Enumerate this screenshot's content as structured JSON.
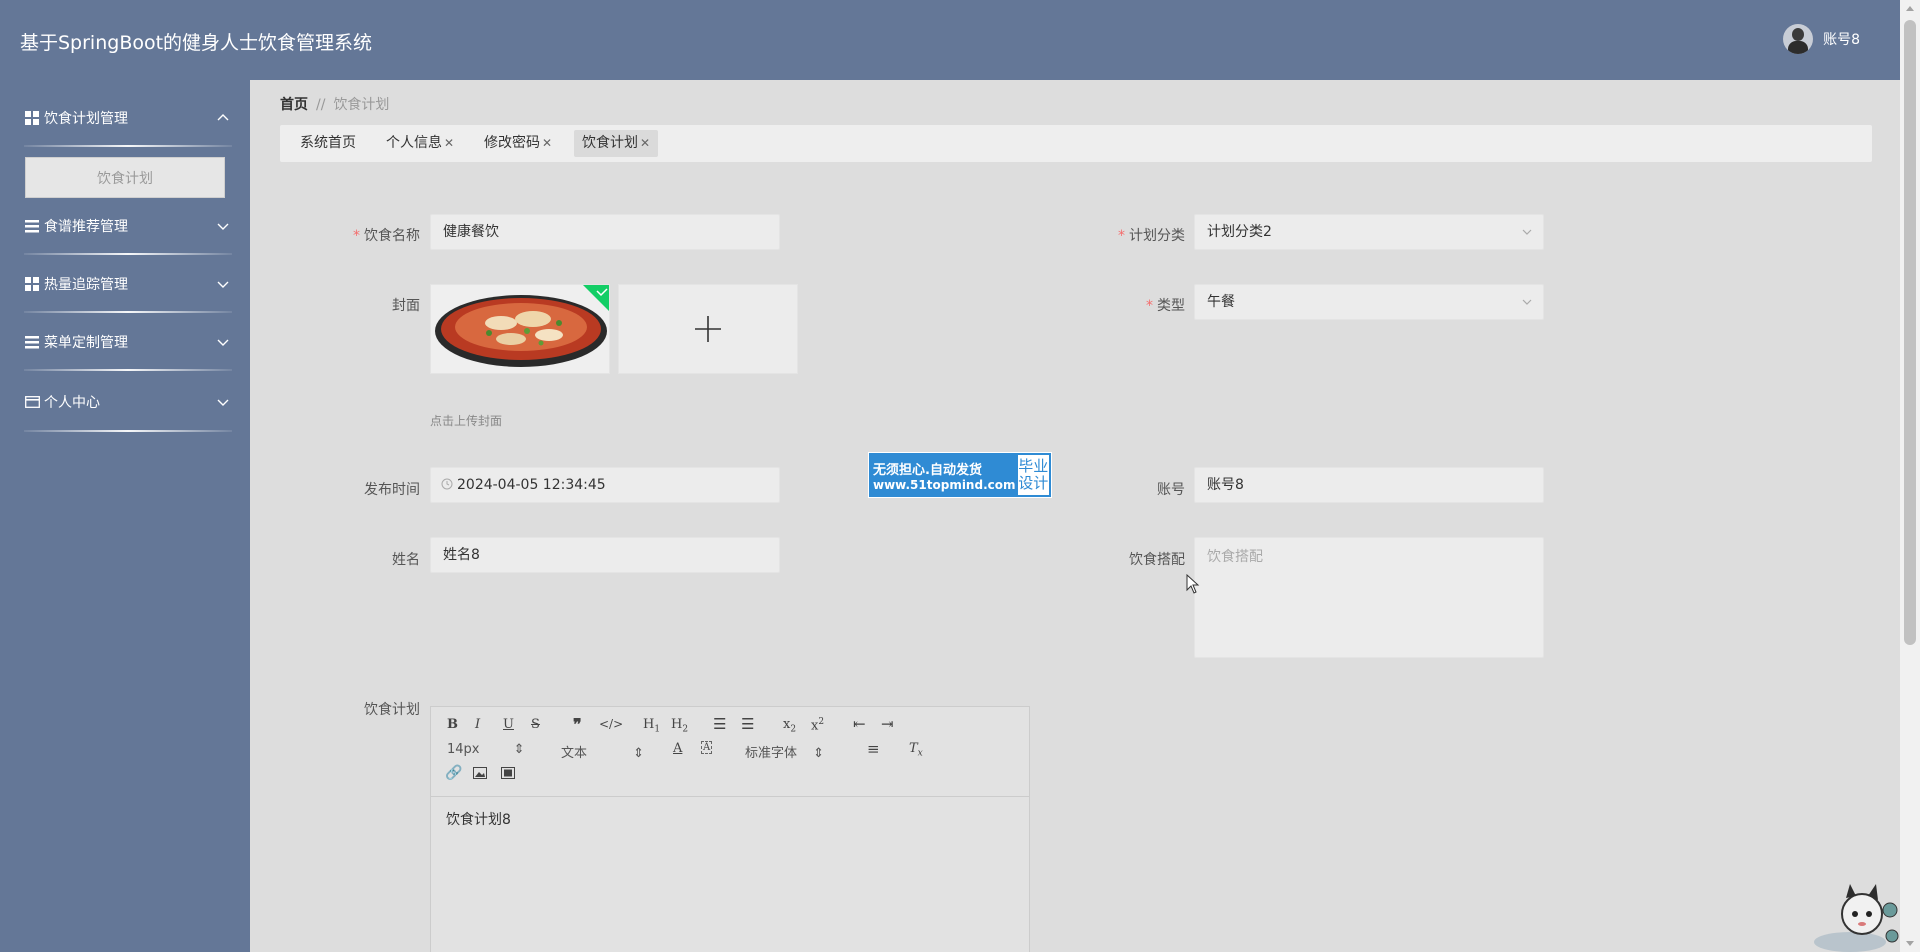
{
  "app": {
    "title": "基于SpringBoot的健身人士饮食管理系统"
  },
  "user": {
    "name": "账号8"
  },
  "sidebar": {
    "items": [
      {
        "label": "饮食计划管理",
        "icon": "grid-icon",
        "expanded": true,
        "submenu": [
          {
            "label": "饮食计划"
          }
        ]
      },
      {
        "label": "食谱推荐管理",
        "icon": "list-icon",
        "expanded": false
      },
      {
        "label": "热量追踪管理",
        "icon": "grid-icon",
        "expanded": false
      },
      {
        "label": "菜单定制管理",
        "icon": "list-icon",
        "expanded": false
      },
      {
        "label": "个人中心",
        "icon": "card-icon",
        "expanded": false
      }
    ]
  },
  "breadcrumb": {
    "home": "首页",
    "separator": "//",
    "current": "饮食计划"
  },
  "tabs": [
    {
      "label": "系统首页",
      "closable": false
    },
    {
      "label": "个人信息",
      "closable": true
    },
    {
      "label": "修改密码",
      "closable": true
    },
    {
      "label": "饮食计划",
      "closable": true,
      "active": true
    }
  ],
  "form": {
    "name": {
      "label": "饮食名称",
      "value": "健康餐饮",
      "required": true
    },
    "category": {
      "label": "计划分类",
      "value": "计划分类2",
      "required": true
    },
    "cover": {
      "label": "封面",
      "tip": "点击上传封面"
    },
    "type": {
      "label": "类型",
      "value": "午餐",
      "required": true
    },
    "publish_time": {
      "label": "发布时间",
      "value": "2024-04-05 12:34:45"
    },
    "account": {
      "label": "账号",
      "value": "账号8"
    },
    "real_name": {
      "label": "姓名",
      "value": "姓名8"
    },
    "diet_match": {
      "label": "饮食搭配",
      "placeholder": "饮食搭配"
    },
    "plan": {
      "label": "饮食计划",
      "content": "饮食计划8"
    }
  },
  "editor": {
    "font_size": "14px",
    "header_select": "文本",
    "font_family": "标准字体",
    "buttons": [
      "bold",
      "italic",
      "underline",
      "strike",
      "blockquote",
      "code-block",
      "h1",
      "h2",
      "ordered-list",
      "bullet-list",
      "subscript",
      "superscript",
      "outdent",
      "indent",
      "link",
      "image",
      "video"
    ]
  },
  "watermark": {
    "line1": "无须担心.自动发货",
    "line2": "www.51topmind.com",
    "right1": "毕业",
    "right2": "设计"
  },
  "colors": {
    "header": "#647797",
    "sidebar": "#647797",
    "main_bg": "#dddddd",
    "required": "#f56c6c",
    "watermark": "#2f8bd4"
  }
}
